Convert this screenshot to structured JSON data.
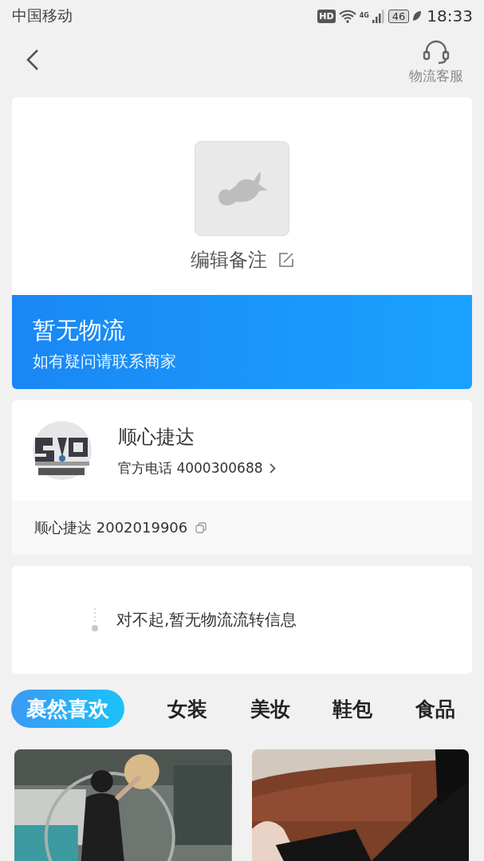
{
  "status_bar": {
    "carrier": "中国移动",
    "hd": "HD",
    "network": "4G",
    "battery": "46",
    "time": "18:33"
  },
  "nav": {
    "service_label": "物流客服"
  },
  "package": {
    "note_label": "编辑备注",
    "status_title": "暂无物流",
    "status_hint": "如有疑问请联系商家"
  },
  "courier": {
    "name": "顺心捷达",
    "phone_label": "官方电话 4000300688",
    "tracking": "顺心捷达 2002019906"
  },
  "timeline": {
    "message": "对不起,暂无物流流转信息"
  },
  "tabs": [
    {
      "label": "裹然喜欢",
      "selected": true
    },
    {
      "label": "女装",
      "selected": false
    },
    {
      "label": "美妆",
      "selected": false
    },
    {
      "label": "鞋包",
      "selected": false
    },
    {
      "label": "食品",
      "selected": false
    }
  ]
}
